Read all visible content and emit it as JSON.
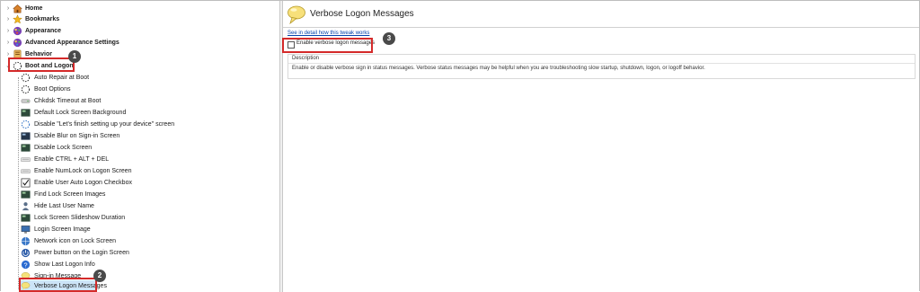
{
  "tree": {
    "top_items": [
      {
        "label": "Home",
        "icon": "home-icon"
      },
      {
        "label": "Bookmarks",
        "icon": "star-icon"
      },
      {
        "label": "Appearance",
        "icon": "appearance-icon"
      },
      {
        "label": "Advanced Appearance Settings",
        "icon": "palette-icon"
      },
      {
        "label": "Behavior",
        "icon": "behavior-icon"
      },
      {
        "label": "Boot and Logon",
        "icon": "boot-logon-icon",
        "expanded": true
      }
    ],
    "children": [
      "Auto Repair at Boot",
      "Boot Options",
      "Chkdsk Timeout at Boot",
      "Default Lock Screen Background",
      "Disable \"Let's finish setting up your device\" screen",
      "Disable Blur on Sign-in Screen",
      "Disable Lock Screen",
      "Enable CTRL + ALT + DEL",
      "Enable NumLock on Logon Screen",
      "Enable User Auto Logon Checkbox",
      "Find Lock Screen Images",
      "Hide Last User Name",
      "Lock Screen Slideshow Duration",
      "Login Screen Image",
      "Network icon on Lock Screen",
      "Power button on the Login Screen",
      "Show Last Logon Info",
      "Sign-in Message",
      "Verbose Logon Messages"
    ],
    "selected": "Verbose Logon Messages"
  },
  "callouts": {
    "one": "1",
    "two": "2",
    "three": "3"
  },
  "detail": {
    "title": "Verbose Logon Messages",
    "tweak_link": "See in detail how this tweak works",
    "checkbox_label": "Enable verbose logon messages",
    "checkbox_checked": false,
    "description_header": "Description",
    "description_text": "Enable or disable verbose sign in status messages. Verbose status messages may be helpful when you are troubleshooting slow startup, shutdown, logon, or logoff behavior."
  },
  "colors": {
    "highlight": "#d42a2a",
    "selection": "#cce4f7",
    "link": "#0645ad",
    "badge": "#4a4a4a"
  }
}
